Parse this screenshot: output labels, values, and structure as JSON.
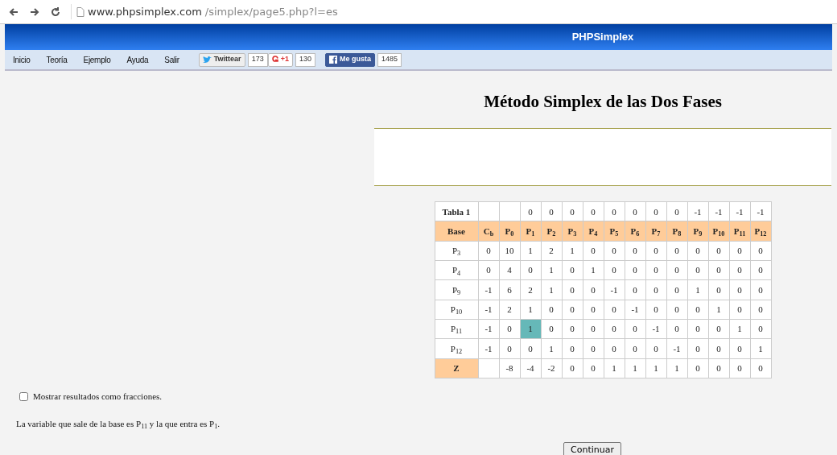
{
  "browser": {
    "url_domain": "www.phpsimplex.com",
    "url_path": "/simplex/page5.php?l=es"
  },
  "header": {
    "title": "PHPSimplex"
  },
  "menu": [
    "Inicio",
    "Teoría",
    "Ejemplo",
    "Ayuda",
    "Salir"
  ],
  "social": [
    {
      "kind": "twitter",
      "label": "Twittear",
      "count": "173"
    },
    {
      "kind": "gplus",
      "label": "+1",
      "count": "130"
    },
    {
      "kind": "facebook",
      "label": "Me gusta",
      "count": "1485"
    }
  ],
  "page_title": "Método Simplex de las Dos Fases",
  "table": {
    "label": "Tabla 1",
    "costs": [
      "0",
      "0",
      "0",
      "0",
      "0",
      "0",
      "0",
      "0",
      "-1",
      "-1",
      "-1",
      "-1"
    ],
    "columns": [
      "Base",
      "C$_{b}$",
      "P$_{0}$",
      "P$_{1}$",
      "P$_{2}$",
      "P$_{3}$",
      "P$_{4}$",
      "P$_{5}$",
      "P$_{6}$",
      "P$_{7}$",
      "P$_{8}$",
      "P$_{9}$",
      "P$_{10}$",
      "P$_{11}$",
      "P$_{12}$"
    ],
    "rows": [
      {
        "kind": "basis",
        "cells": [
          {
            "text": "P$_{3}$",
            "selected": false
          },
          {
            "text": "0",
            "selected": false
          },
          {
            "text": "10",
            "selected": false
          },
          {
            "text": "1",
            "selected": false
          },
          {
            "text": "2",
            "selected": false
          },
          {
            "text": "1",
            "selected": false
          },
          {
            "text": "0",
            "selected": false
          },
          {
            "text": "0",
            "selected": false
          },
          {
            "text": "0",
            "selected": false
          },
          {
            "text": "0",
            "selected": false
          },
          {
            "text": "0",
            "selected": false
          },
          {
            "text": "0",
            "selected": false
          },
          {
            "text": "0",
            "selected": false
          },
          {
            "text": "0",
            "selected": false
          },
          {
            "text": "0",
            "selected": false
          }
        ]
      },
      {
        "kind": "basis",
        "cells": [
          {
            "text": "P$_{4}$",
            "selected": false
          },
          {
            "text": "0",
            "selected": false
          },
          {
            "text": "4",
            "selected": false
          },
          {
            "text": "0",
            "selected": false
          },
          {
            "text": "1",
            "selected": false
          },
          {
            "text": "0",
            "selected": false
          },
          {
            "text": "1",
            "selected": false
          },
          {
            "text": "0",
            "selected": false
          },
          {
            "text": "0",
            "selected": false
          },
          {
            "text": "0",
            "selected": false
          },
          {
            "text": "0",
            "selected": false
          },
          {
            "text": "0",
            "selected": false
          },
          {
            "text": "0",
            "selected": false
          },
          {
            "text": "0",
            "selected": false
          },
          {
            "text": "0",
            "selected": false
          }
        ]
      },
      {
        "kind": "basis",
        "cells": [
          {
            "text": "P$_{9}$",
            "selected": false
          },
          {
            "text": "-1",
            "selected": false
          },
          {
            "text": "6",
            "selected": false
          },
          {
            "text": "2",
            "selected": false
          },
          {
            "text": "1",
            "selected": false
          },
          {
            "text": "0",
            "selected": false
          },
          {
            "text": "0",
            "selected": false
          },
          {
            "text": "-1",
            "selected": false
          },
          {
            "text": "0",
            "selected": false
          },
          {
            "text": "0",
            "selected": false
          },
          {
            "text": "0",
            "selected": false
          },
          {
            "text": "1",
            "selected": false
          },
          {
            "text": "0",
            "selected": false
          },
          {
            "text": "0",
            "selected": false
          },
          {
            "text": "0",
            "selected": false
          }
        ]
      },
      {
        "kind": "basis",
        "cells": [
          {
            "text": "P$_{10}$",
            "selected": false
          },
          {
            "text": "-1",
            "selected": false
          },
          {
            "text": "2",
            "selected": false
          },
          {
            "text": "1",
            "selected": false
          },
          {
            "text": "0",
            "selected": false
          },
          {
            "text": "0",
            "selected": false
          },
          {
            "text": "0",
            "selected": false
          },
          {
            "text": "0",
            "selected": false
          },
          {
            "text": "-1",
            "selected": false
          },
          {
            "text": "0",
            "selected": false
          },
          {
            "text": "0",
            "selected": false
          },
          {
            "text": "0",
            "selected": false
          },
          {
            "text": "1",
            "selected": false
          },
          {
            "text": "0",
            "selected": false
          },
          {
            "text": "0",
            "selected": false
          }
        ]
      },
      {
        "kind": "basis",
        "cells": [
          {
            "text": "P$_{11}$",
            "selected": false
          },
          {
            "text": "-1",
            "selected": false
          },
          {
            "text": "0",
            "selected": false
          },
          {
            "text": "1",
            "selected": true
          },
          {
            "text": "0",
            "selected": false
          },
          {
            "text": "0",
            "selected": false
          },
          {
            "text": "0",
            "selected": false
          },
          {
            "text": "0",
            "selected": false
          },
          {
            "text": "0",
            "selected": false
          },
          {
            "text": "-1",
            "selected": false
          },
          {
            "text": "0",
            "selected": false
          },
          {
            "text": "0",
            "selected": false
          },
          {
            "text": "0",
            "selected": false
          },
          {
            "text": "1",
            "selected": false
          },
          {
            "text": "0",
            "selected": false
          }
        ]
      },
      {
        "kind": "basis",
        "cells": [
          {
            "text": "P$_{12}$",
            "selected": false
          },
          {
            "text": "-1",
            "selected": false
          },
          {
            "text": "0",
            "selected": false
          },
          {
            "text": "0",
            "selected": false
          },
          {
            "text": "1",
            "selected": false
          },
          {
            "text": "0",
            "selected": false
          },
          {
            "text": "0",
            "selected": false
          },
          {
            "text": "0",
            "selected": false
          },
          {
            "text": "0",
            "selected": false
          },
          {
            "text": "0",
            "selected": false
          },
          {
            "text": "-1",
            "selected": false
          },
          {
            "text": "0",
            "selected": false
          },
          {
            "text": "0",
            "selected": false
          },
          {
            "text": "0",
            "selected": false
          },
          {
            "text": "1",
            "selected": false
          }
        ]
      },
      {
        "kind": "total",
        "cells": [
          {
            "text": "Z",
            "selected": false
          },
          {
            "selected": false
          },
          {
            "text": "-8",
            "selected": false
          },
          {
            "text": "-4",
            "selected": false
          },
          {
            "text": "-2",
            "selected": false
          },
          {
            "text": "0",
            "selected": false
          },
          {
            "text": "0",
            "selected": false
          },
          {
            "text": "1",
            "selected": false
          },
          {
            "text": "1",
            "selected": false
          },
          {
            "text": "1",
            "selected": false
          },
          {
            "text": "1",
            "selected": false
          },
          {
            "text": "0",
            "selected": false
          },
          {
            "text": "0",
            "selected": false
          },
          {
            "text": "0",
            "selected": false
          },
          {
            "text": "0",
            "selected": false
          }
        ]
      }
    ]
  },
  "fractions_option": {
    "label": "Mostrar resultados como fracciones.",
    "checked": false
  },
  "message": "La variable que sale de la base es P$_{11}$ y la que entra es P$_{1}$.",
  "continue_button": "Continuar"
}
